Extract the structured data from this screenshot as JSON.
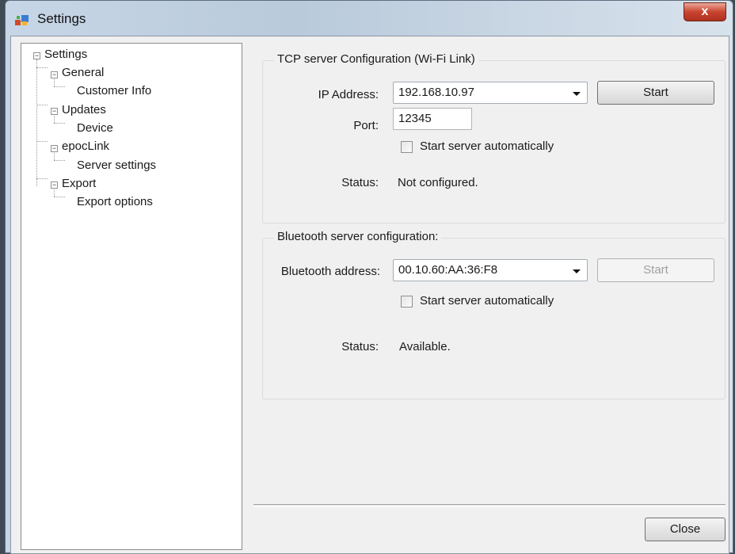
{
  "window": {
    "title": "Settings",
    "close_glyph": "x"
  },
  "tree": {
    "items": [
      {
        "label": "Settings"
      },
      {
        "label": "General"
      },
      {
        "label": "Customer Info"
      },
      {
        "label": "Updates"
      },
      {
        "label": "Device"
      },
      {
        "label": "epocLink"
      },
      {
        "label": "Server settings"
      },
      {
        "label": "Export"
      },
      {
        "label": "Export options"
      }
    ],
    "expander_glyph": "−"
  },
  "tcp": {
    "legend": "TCP server Configuration (Wi-Fi Link)",
    "ip_label": "IP Address:",
    "ip_value": "192.168.10.97",
    "start_label": "Start",
    "port_label": "Port:",
    "port_value": "12345",
    "auto_start_label": "Start server automatically",
    "status_label": "Status:",
    "status_value": "Not configured."
  },
  "bluetooth": {
    "legend": "Bluetooth server configuration:",
    "address_label": "Bluetooth address:",
    "address_value": "00.10.60:AA:36:F8",
    "start_label": "Start",
    "auto_start_label": "Start server automatically",
    "status_label": "Status:",
    "status_value": "Available."
  },
  "footer": {
    "close_label": "Close"
  },
  "icons": {
    "app": "settings-app-icon",
    "close": "close-icon",
    "dropdown": "chevron-down-icon"
  },
  "colors": {
    "close_button": "#c8452f",
    "selection": "#ffffff"
  }
}
